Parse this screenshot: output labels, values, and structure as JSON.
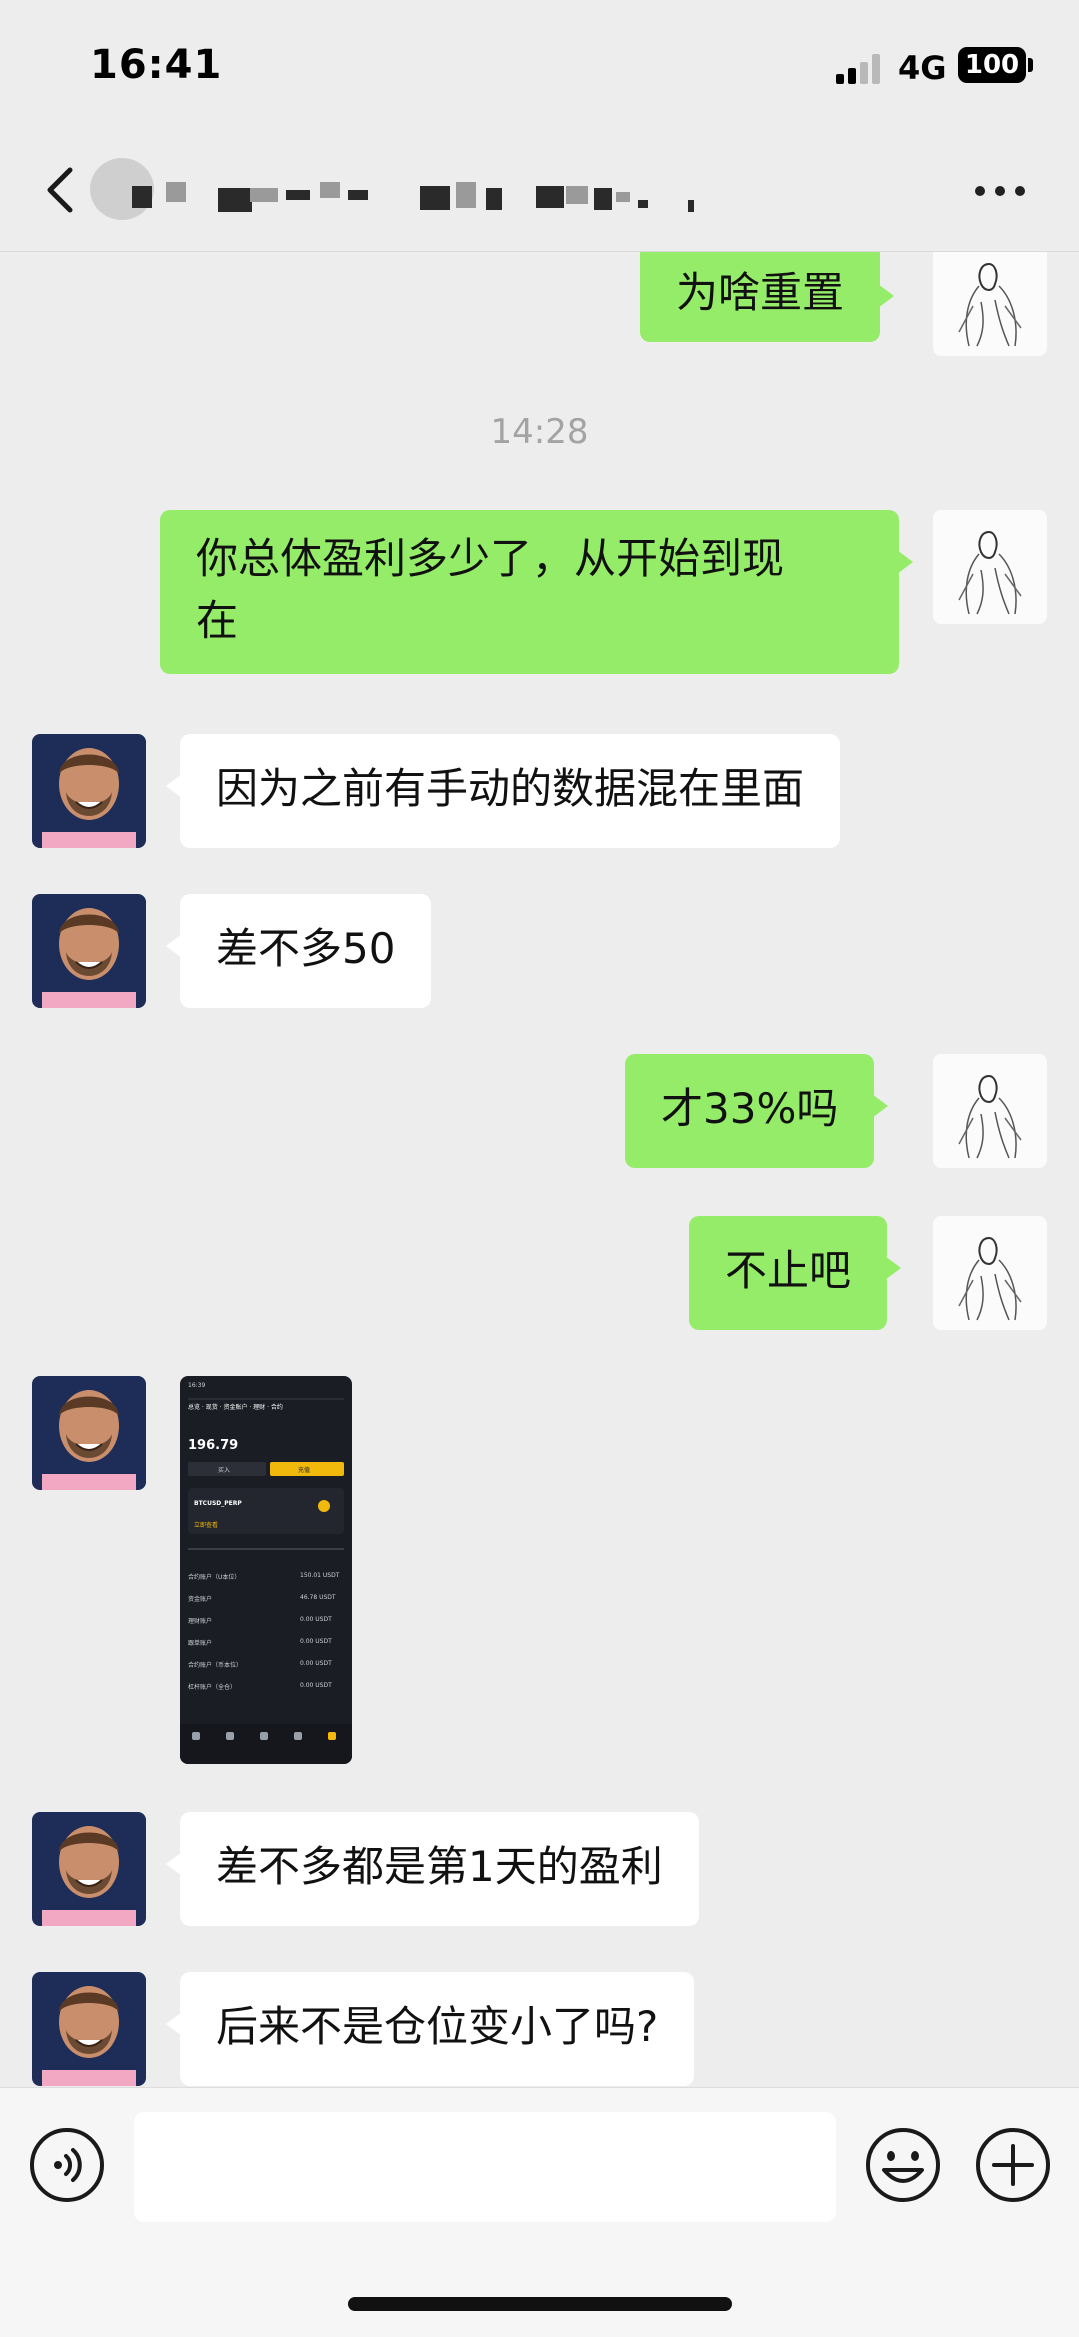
{
  "status_bar": {
    "time": "16:41",
    "network": "4G",
    "battery": "100"
  },
  "header": {
    "title": "",
    "back_icon": "chevron-left-icon",
    "more_icon": "more-horizontal-icon"
  },
  "chat": {
    "messages": [
      {
        "side": "out",
        "type": "text",
        "text": "为啥重置"
      },
      {
        "type": "time",
        "text": "14:28"
      },
      {
        "side": "out",
        "type": "text",
        "text": "你总体盈利多少了，从开始到现\n在"
      },
      {
        "side": "in",
        "type": "text",
        "text": "因为之前有手动的数据混在里面"
      },
      {
        "side": "in",
        "type": "text",
        "text": "差不多50"
      },
      {
        "side": "out",
        "type": "text",
        "text": "才33%吗"
      },
      {
        "side": "out",
        "type": "text",
        "text": "不止吧"
      },
      {
        "side": "in",
        "type": "image",
        "text": ""
      },
      {
        "side": "in",
        "type": "text",
        "text": "差不多都是第1天的盈利"
      },
      {
        "side": "in",
        "type": "text",
        "text": "后来不是仓位变小了吗?"
      }
    ],
    "image_preview": {
      "balance": "196.79",
      "buy_label": "买入",
      "deposit_label": "充值",
      "symbol": "BTCUSD_PERP",
      "rows": [
        {
          "label": "合约账户（U本位）",
          "value": "150.01 USDT"
        },
        {
          "label": "资金账户",
          "value": "46.78 USDT"
        },
        {
          "label": "理财账户",
          "value": "0.00 USDT"
        },
        {
          "label": "跟单账户",
          "value": "0.00 USDT"
        },
        {
          "label": "合约账户（币本位）",
          "value": "0.00 USDT"
        },
        {
          "label": "杠杆账户（全仓）",
          "value": "0.00 USDT"
        }
      ]
    }
  },
  "input_bar": {
    "placeholder": "",
    "voice_icon": "voice-icon",
    "emoji_icon": "emoji-icon",
    "plus_icon": "plus-icon"
  },
  "colors": {
    "background": "#ededed",
    "outgoing_bubble": "#95ec69",
    "incoming_bubble": "#ffffff",
    "timestamp": "#a3a3a3"
  }
}
